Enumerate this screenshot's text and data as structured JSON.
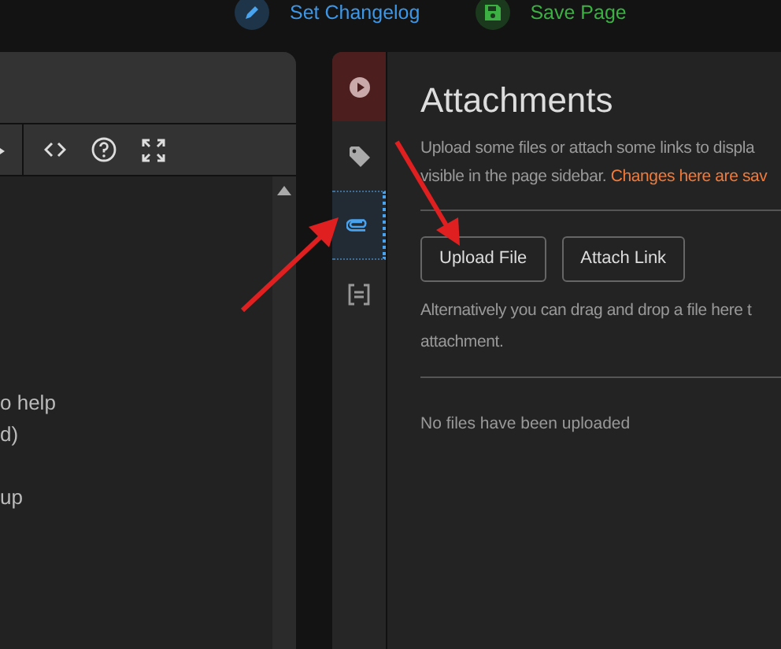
{
  "top_actions": [
    {
      "kind": "changelog",
      "label": "Set Changelog"
    },
    {
      "kind": "save",
      "label": "Save Page"
    }
  ],
  "editor": {
    "toolbar": [
      {
        "kind": "code"
      },
      {
        "kind": "help"
      },
      {
        "kind": "fullscreen"
      }
    ],
    "paragraphs": [
      {
        "lines": [
          "o help",
          "d)"
        ]
      },
      {
        "lines": [
          "up"
        ]
      }
    ]
  },
  "sidebar_tabs": [
    {
      "kind": "toggle",
      "selected": false
    },
    {
      "kind": "tags",
      "selected": false
    },
    {
      "kind": "attachments",
      "selected": true
    },
    {
      "kind": "templates",
      "selected": false
    }
  ],
  "panel": {
    "title": "Attachments",
    "description_lines": [
      "Upload some files or attach some links to displa",
      "visible in the page sidebar. **Changes here are sav**"
    ],
    "buttons": [
      "Upload File",
      "Attach Link"
    ],
    "hint_lines": [
      "Alternatively you can drag and drop a file here t",
      "attachment."
    ],
    "empty_message": "No files have been uploaded"
  }
}
